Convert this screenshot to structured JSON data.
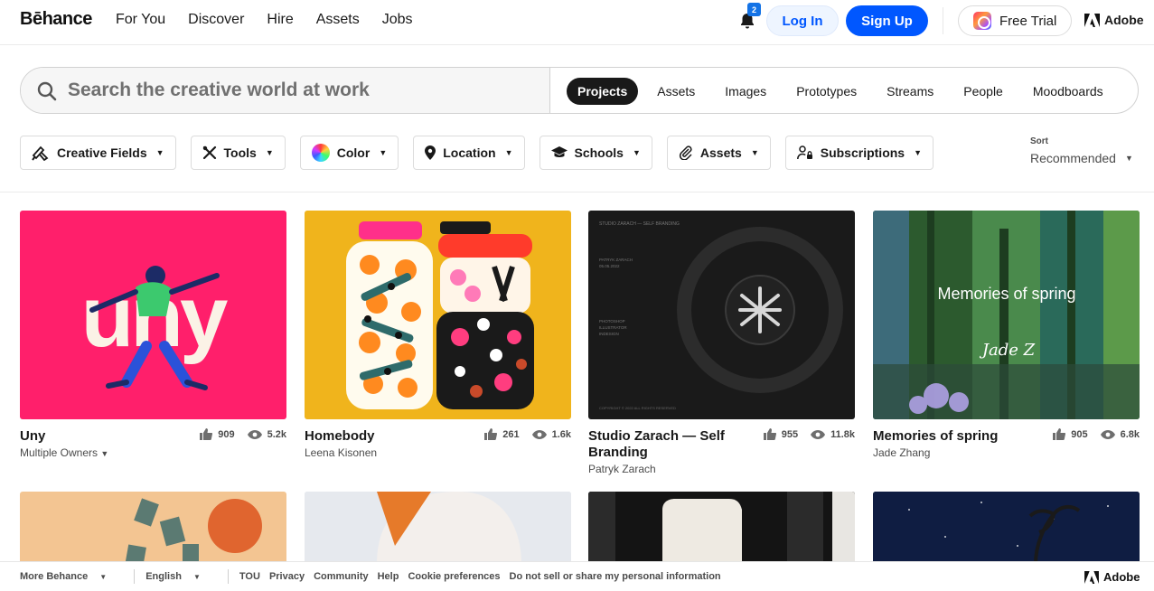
{
  "nav": {
    "logo": "Bēhance",
    "links": [
      "For You",
      "Discover",
      "Hire",
      "Assets",
      "Jobs"
    ],
    "notification_count": "2",
    "login_label": "Log In",
    "signup_label": "Sign Up",
    "trial_label": "Free Trial",
    "adobe_label": "Adobe"
  },
  "search": {
    "placeholder": "Search the creative world at work",
    "tabs": [
      "Projects",
      "Assets",
      "Images",
      "Prototypes",
      "Streams",
      "People",
      "Moodboards"
    ],
    "active_tab": "Projects"
  },
  "filters": {
    "items": [
      "Creative Fields",
      "Tools",
      "Color",
      "Location",
      "Schools",
      "Assets",
      "Subscriptions"
    ],
    "sort_label": "Sort",
    "sort_value": "Recommended"
  },
  "projects": [
    {
      "title": "Uny",
      "owner": "Multiple Owners",
      "likes": "909",
      "views": "5.2k"
    },
    {
      "title": "Homebody",
      "owner": "Leena Kisonen",
      "likes": "261",
      "views": "1.6k"
    },
    {
      "title": "Studio Zarach — Self Branding",
      "owner": "Patryk Zarach",
      "likes": "955",
      "views": "11.8k"
    },
    {
      "title": "Memories of spring",
      "owner": "Jade Zhang",
      "likes": "905",
      "views": "6.8k"
    }
  ],
  "thumb_text": {
    "uny_word": "uny",
    "studio_header": "STUDIO ZARACH — SELF BRANDING",
    "studio_author": "PATRYK ZARACH",
    "studio_date": "05.05.2022",
    "studio_tools": [
      "PHOTOSHOP",
      "ILLUSTRATOR",
      "INDESIGN"
    ],
    "studio_copyright": "COPYRIGHT © 2022 ALL RIGHTS RESERVED",
    "spring_title": "Memories of spring",
    "spring_sig": "Jade Z"
  },
  "footer": {
    "more": "More Behance",
    "language": "English",
    "links": [
      "TOU",
      "Privacy",
      "Community",
      "Help",
      "Cookie preferences",
      "Do not sell or share my personal information"
    ],
    "adobe_label": "Adobe"
  },
  "colors": {
    "brand_blue": "#0057ff",
    "uny_bg": "#ff1f6b",
    "homebody_bg": "#f0b41c",
    "studio_bg": "#1a1a1a"
  }
}
